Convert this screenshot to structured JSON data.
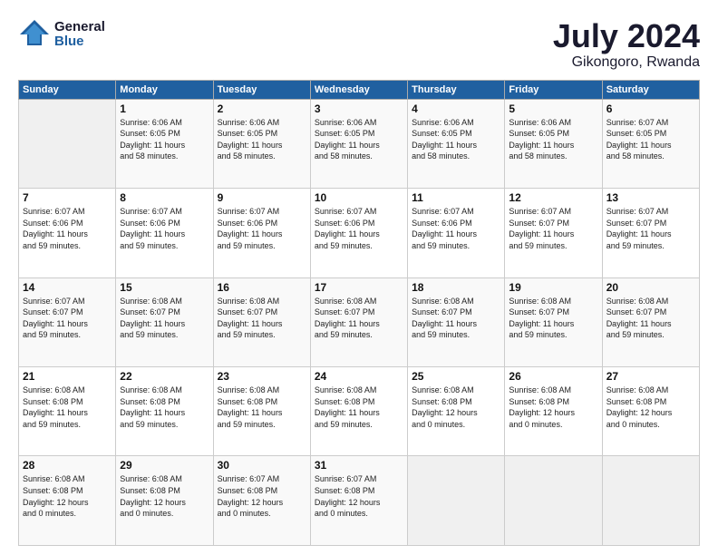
{
  "header": {
    "logo_line1": "General",
    "logo_line2": "Blue",
    "month_year": "July 2024",
    "location": "Gikongoro, Rwanda"
  },
  "weekdays": [
    "Sunday",
    "Monday",
    "Tuesday",
    "Wednesday",
    "Thursday",
    "Friday",
    "Saturday"
  ],
  "weeks": [
    [
      {
        "day": "",
        "info": ""
      },
      {
        "day": "1",
        "info": "Sunrise: 6:06 AM\nSunset: 6:05 PM\nDaylight: 11 hours\nand 58 minutes."
      },
      {
        "day": "2",
        "info": "Sunrise: 6:06 AM\nSunset: 6:05 PM\nDaylight: 11 hours\nand 58 minutes."
      },
      {
        "day": "3",
        "info": "Sunrise: 6:06 AM\nSunset: 6:05 PM\nDaylight: 11 hours\nand 58 minutes."
      },
      {
        "day": "4",
        "info": "Sunrise: 6:06 AM\nSunset: 6:05 PM\nDaylight: 11 hours\nand 58 minutes."
      },
      {
        "day": "5",
        "info": "Sunrise: 6:06 AM\nSunset: 6:05 PM\nDaylight: 11 hours\nand 58 minutes."
      },
      {
        "day": "6",
        "info": "Sunrise: 6:07 AM\nSunset: 6:05 PM\nDaylight: 11 hours\nand 58 minutes."
      }
    ],
    [
      {
        "day": "7",
        "info": "Sunrise: 6:07 AM\nSunset: 6:06 PM\nDaylight: 11 hours\nand 59 minutes."
      },
      {
        "day": "8",
        "info": "Sunrise: 6:07 AM\nSunset: 6:06 PM\nDaylight: 11 hours\nand 59 minutes."
      },
      {
        "day": "9",
        "info": "Sunrise: 6:07 AM\nSunset: 6:06 PM\nDaylight: 11 hours\nand 59 minutes."
      },
      {
        "day": "10",
        "info": "Sunrise: 6:07 AM\nSunset: 6:06 PM\nDaylight: 11 hours\nand 59 minutes."
      },
      {
        "day": "11",
        "info": "Sunrise: 6:07 AM\nSunset: 6:06 PM\nDaylight: 11 hours\nand 59 minutes."
      },
      {
        "day": "12",
        "info": "Sunrise: 6:07 AM\nSunset: 6:07 PM\nDaylight: 11 hours\nand 59 minutes."
      },
      {
        "day": "13",
        "info": "Sunrise: 6:07 AM\nSunset: 6:07 PM\nDaylight: 11 hours\nand 59 minutes."
      }
    ],
    [
      {
        "day": "14",
        "info": "Sunrise: 6:07 AM\nSunset: 6:07 PM\nDaylight: 11 hours\nand 59 minutes."
      },
      {
        "day": "15",
        "info": "Sunrise: 6:08 AM\nSunset: 6:07 PM\nDaylight: 11 hours\nand 59 minutes."
      },
      {
        "day": "16",
        "info": "Sunrise: 6:08 AM\nSunset: 6:07 PM\nDaylight: 11 hours\nand 59 minutes."
      },
      {
        "day": "17",
        "info": "Sunrise: 6:08 AM\nSunset: 6:07 PM\nDaylight: 11 hours\nand 59 minutes."
      },
      {
        "day": "18",
        "info": "Sunrise: 6:08 AM\nSunset: 6:07 PM\nDaylight: 11 hours\nand 59 minutes."
      },
      {
        "day": "19",
        "info": "Sunrise: 6:08 AM\nSunset: 6:07 PM\nDaylight: 11 hours\nand 59 minutes."
      },
      {
        "day": "20",
        "info": "Sunrise: 6:08 AM\nSunset: 6:07 PM\nDaylight: 11 hours\nand 59 minutes."
      }
    ],
    [
      {
        "day": "21",
        "info": "Sunrise: 6:08 AM\nSunset: 6:08 PM\nDaylight: 11 hours\nand 59 minutes."
      },
      {
        "day": "22",
        "info": "Sunrise: 6:08 AM\nSunset: 6:08 PM\nDaylight: 11 hours\nand 59 minutes."
      },
      {
        "day": "23",
        "info": "Sunrise: 6:08 AM\nSunset: 6:08 PM\nDaylight: 11 hours\nand 59 minutes."
      },
      {
        "day": "24",
        "info": "Sunrise: 6:08 AM\nSunset: 6:08 PM\nDaylight: 11 hours\nand 59 minutes."
      },
      {
        "day": "25",
        "info": "Sunrise: 6:08 AM\nSunset: 6:08 PM\nDaylight: 12 hours\nand 0 minutes."
      },
      {
        "day": "26",
        "info": "Sunrise: 6:08 AM\nSunset: 6:08 PM\nDaylight: 12 hours\nand 0 minutes."
      },
      {
        "day": "27",
        "info": "Sunrise: 6:08 AM\nSunset: 6:08 PM\nDaylight: 12 hours\nand 0 minutes."
      }
    ],
    [
      {
        "day": "28",
        "info": "Sunrise: 6:08 AM\nSunset: 6:08 PM\nDaylight: 12 hours\nand 0 minutes."
      },
      {
        "day": "29",
        "info": "Sunrise: 6:08 AM\nSunset: 6:08 PM\nDaylight: 12 hours\nand 0 minutes."
      },
      {
        "day": "30",
        "info": "Sunrise: 6:07 AM\nSunset: 6:08 PM\nDaylight: 12 hours\nand 0 minutes."
      },
      {
        "day": "31",
        "info": "Sunrise: 6:07 AM\nSunset: 6:08 PM\nDaylight: 12 hours\nand 0 minutes."
      },
      {
        "day": "",
        "info": ""
      },
      {
        "day": "",
        "info": ""
      },
      {
        "day": "",
        "info": ""
      }
    ]
  ]
}
